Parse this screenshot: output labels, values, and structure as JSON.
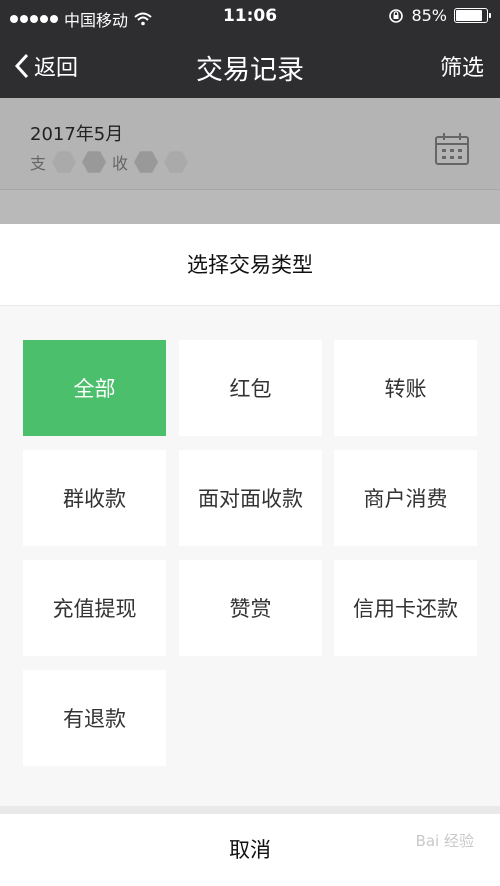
{
  "status_bar": {
    "carrier": "中国移动",
    "time": "11:06",
    "battery": "85%",
    "battery_level": 0.85
  },
  "nav": {
    "back_label": "返回",
    "title": "交易记录",
    "filter_label": "筛选"
  },
  "summary": {
    "month": "2017年5月",
    "expense_label": "支",
    "income_label": "收"
  },
  "sheet": {
    "title": "选择交易类型",
    "options": [
      {
        "label": "全部",
        "selected": true
      },
      {
        "label": "红包",
        "selected": false
      },
      {
        "label": "转账",
        "selected": false
      },
      {
        "label": "群收款",
        "selected": false
      },
      {
        "label": "面对面收款",
        "selected": false
      },
      {
        "label": "商户消费",
        "selected": false
      },
      {
        "label": "充值提现",
        "selected": false
      },
      {
        "label": "赞赏",
        "selected": false
      },
      {
        "label": "信用卡还款",
        "selected": false
      },
      {
        "label": "有退款",
        "selected": false
      }
    ],
    "cancel_label": "取消"
  },
  "watermark": "Bai 经验",
  "colors": {
    "selected": "#4bbf6b",
    "nav_bg": "#2e2e31"
  },
  "icons": [
    "wifi-icon",
    "lock-rotation-icon",
    "battery-icon",
    "back-chevron-icon",
    "calendar-icon"
  ]
}
